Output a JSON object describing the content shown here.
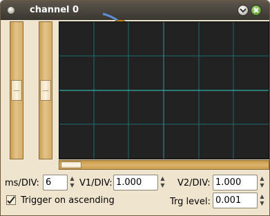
{
  "window": {
    "title": "channel 0",
    "menu_icon": "window-menu-icon",
    "minimize_icon": "chevron-down-icon",
    "close_icon": "close-icon",
    "accent_color": "#efe4cd",
    "close_color": "#6aa83b"
  },
  "scope": {
    "background": "#222222",
    "grid_color": "#1f7f7f",
    "trace_color": "#2fd0d0"
  },
  "controls": {
    "ms_div": {
      "label": "ms/DIV:",
      "value": "6"
    },
    "v1_div": {
      "label": "V1/DIV:",
      "value": "1.000"
    },
    "v2_div": {
      "label": "V2/DIV:",
      "value": "1.000"
    },
    "trigger": {
      "label": "Trigger on ascending",
      "checked": true
    },
    "trg_level": {
      "label": "Trg level:",
      "value": "0.001"
    }
  },
  "sliders": {
    "channel_1_level": 0.5,
    "channel_2_level": 0.5,
    "horizontal_scroll": 0.0
  }
}
